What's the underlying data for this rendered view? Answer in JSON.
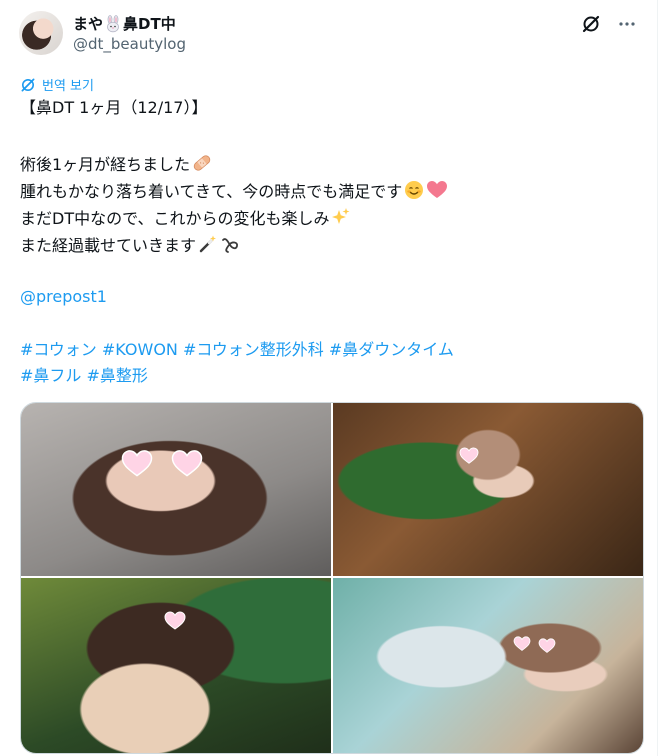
{
  "user": {
    "display_name_prefix": "まや",
    "display_name_suffix": "鼻DT中",
    "name_emoji": "rabbit-face",
    "handle": "@dt_beautylog"
  },
  "header_icons": [
    "grok-icon",
    "more-icon"
  ],
  "translate_label": "번역 보기",
  "tweet": {
    "title": "【鼻DT 1ヶ月（12/17）】",
    "line1": "術後1ヶ月が経ちました",
    "line2": "腫れもかなり落ち着いてきて、今の時点でも満足です",
    "line3": "まだDT中なので、これからの変化も楽しみ",
    "line4": "また経過載せていきます",
    "mention": "@prepost1",
    "hashtags_line1": [
      "#コウォン",
      "#KOWON",
      "#コウォン整形外科",
      "#鼻ダウンタイム"
    ],
    "hashtags_line2": [
      "#鼻フル",
      "#鼻整形"
    ]
  },
  "emojis": [
    "bandage-icon",
    "smiling-face-icon",
    "heart-icon",
    "sparkles-icon",
    "magic-wand-icon",
    "loop-icon"
  ],
  "colors": {
    "link": "#1d9bf0",
    "text": "#0f1419",
    "secondary": "#536471",
    "border": "#cfd9de",
    "heart_sticker": "#ffd4e6"
  },
  "photos": [
    "photo-1",
    "photo-2",
    "photo-3",
    "photo-4"
  ]
}
